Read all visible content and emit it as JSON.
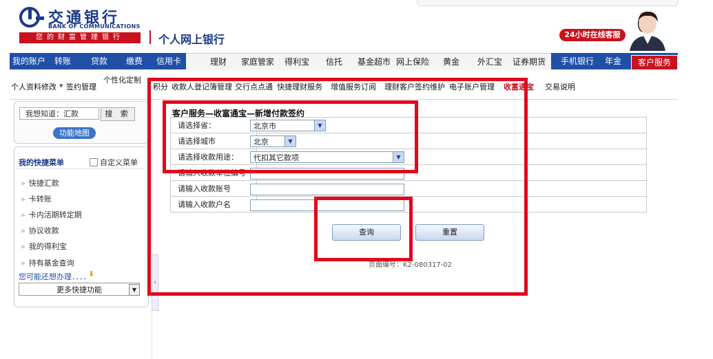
{
  "header": {
    "bank_name_cn": "交通银行",
    "bank_name_en": "BANK OF COMMUNICATIONS",
    "slogan": "您的财富管理银行",
    "site_title": "个人网上银行",
    "hotline": "24小时在线客服"
  },
  "nav": {
    "left_items": [
      "我的账户",
      "转账",
      "贷款",
      "缴费",
      "信用卡"
    ],
    "mid_items": [
      "理财",
      "家庭管家",
      "得利宝",
      "信托",
      "基金超市",
      "网上保险",
      "黄金",
      "外汇宝",
      "证券期货"
    ],
    "right_items": [
      "手机银行",
      "年金"
    ],
    "active": "客户服务"
  },
  "subnav": {
    "personal_label": "个性化定制",
    "items": [
      "个人资料修改",
      "签约管理",
      "积分",
      "收款人登记簿管理",
      "交行点点通",
      "快捷理财服务",
      "增值服务订阅",
      "理财客户签约维护",
      "电子账户管理",
      "收富通宝",
      "交易说明"
    ]
  },
  "sidebar": {
    "know_placeholder": "我想知道：汇款",
    "search_label": "搜 索",
    "map_label": "功能地图",
    "quick_title": "我的快捷菜单",
    "custom_menu": "自定义菜单",
    "quick_items": [
      "快捷汇款",
      "卡转账",
      "卡内活期转定期",
      "协议收款",
      "我的得利宝",
      "持有基金查询"
    ],
    "maybe_label": "您可能还想办理．．．．",
    "more_label": "更多快捷功能"
  },
  "form": {
    "title": "客户服务—收富通宝—新增付款签约",
    "rows": [
      {
        "label": "请选择省：",
        "value": "北京市"
      },
      {
        "label": "请选择城市",
        "value": "北京"
      },
      {
        "label": "请选择收款用途：",
        "value": "代扣其它款项"
      },
      {
        "label": "请输入收款单位编号",
        "value": ""
      },
      {
        "label": "请输入收款账号",
        "value": ""
      },
      {
        "label": "请输入收款户名",
        "value": ""
      }
    ],
    "query_label": "查询",
    "reset_label": "重置",
    "page_no": "页面编号：K2-080317-02"
  },
  "colors": {
    "brand_blue": "#1f4fa6",
    "brand_red": "#c9121d",
    "annotation_red": "#e1071d"
  }
}
